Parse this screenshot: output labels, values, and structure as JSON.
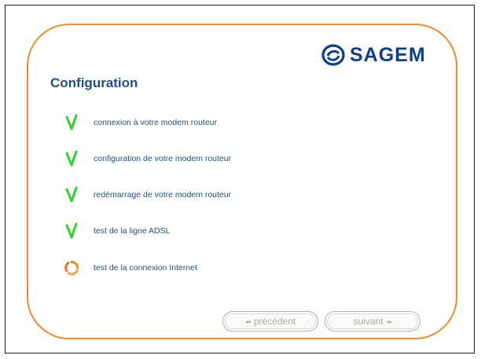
{
  "brand": {
    "name": "SAGEM",
    "color": "#0d3f8f",
    "icon": "sagem-logo-icon"
  },
  "accent_color": "#f28c28",
  "title": "Configuration",
  "steps": [
    {
      "label": "connexion à votre modem routeur",
      "status": "done",
      "icon": "check-icon",
      "color": "#2ed12e"
    },
    {
      "label": "configuration de votre modem routeur",
      "status": "done",
      "icon": "check-icon",
      "color": "#2ed12e"
    },
    {
      "label": "redémarrage de votre modem routeur",
      "status": "done",
      "icon": "check-icon",
      "color": "#2ed12e"
    },
    {
      "label": "test de la ligne ADSL",
      "status": "done",
      "icon": "check-icon",
      "color": "#2ed12e"
    },
    {
      "label": "test de la connexion Internet",
      "status": "in-progress",
      "icon": "spinner-icon",
      "color": "#f28c28"
    }
  ],
  "nav": {
    "previous": {
      "label": "précédent",
      "arrows": "◂◂",
      "enabled": false
    },
    "next": {
      "label": "suivant",
      "arrows": "▸▸",
      "enabled": false
    }
  }
}
